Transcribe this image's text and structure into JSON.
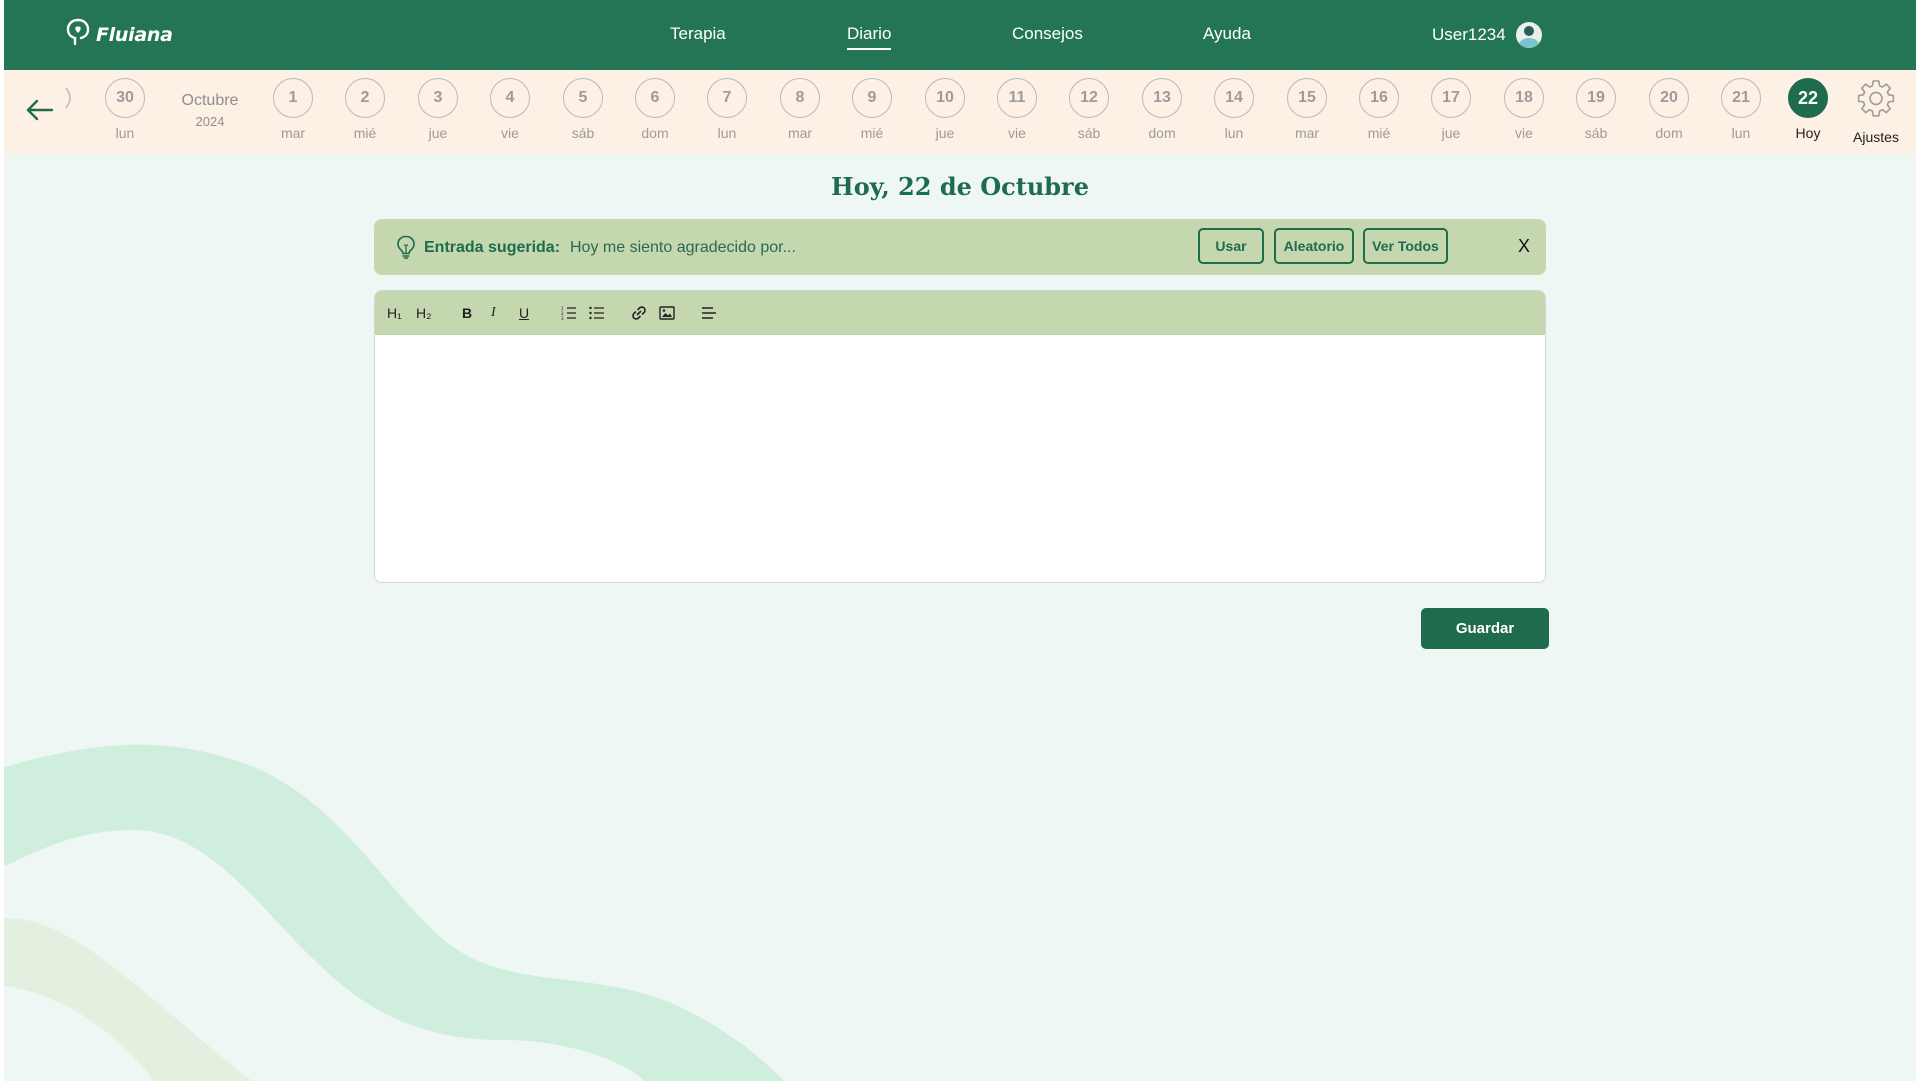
{
  "brand": {
    "name": "Fluiana"
  },
  "nav": {
    "items": [
      {
        "label": "Terapia"
      },
      {
        "label": "Diario",
        "active": true
      },
      {
        "label": "Consejos"
      },
      {
        "label": "Ayuda"
      }
    ],
    "user": "User1234"
  },
  "calendar": {
    "first_day": {
      "num": "30",
      "dow": "lun"
    },
    "month": "Octubre",
    "year": "2024",
    "days": [
      {
        "num": "1",
        "dow": "mar"
      },
      {
        "num": "2",
        "dow": "mié"
      },
      {
        "num": "3",
        "dow": "jue"
      },
      {
        "num": "4",
        "dow": "vie"
      },
      {
        "num": "5",
        "dow": "sáb"
      },
      {
        "num": "6",
        "dow": "dom"
      },
      {
        "num": "7",
        "dow": "lun"
      },
      {
        "num": "8",
        "dow": "mar"
      },
      {
        "num": "9",
        "dow": "mié"
      },
      {
        "num": "10",
        "dow": "jue"
      },
      {
        "num": "11",
        "dow": "vie"
      },
      {
        "num": "12",
        "dow": "sáb"
      },
      {
        "num": "13",
        "dow": "dom"
      },
      {
        "num": "14",
        "dow": "lun"
      },
      {
        "num": "15",
        "dow": "mar"
      },
      {
        "num": "16",
        "dow": "mié"
      },
      {
        "num": "17",
        "dow": "jue"
      },
      {
        "num": "18",
        "dow": "vie"
      },
      {
        "num": "19",
        "dow": "sáb"
      },
      {
        "num": "20",
        "dow": "dom"
      },
      {
        "num": "21",
        "dow": "lun"
      }
    ],
    "today": {
      "num": "22",
      "dow": "Hoy"
    },
    "settings_label": "Ajustes"
  },
  "page": {
    "title": "Hoy, 22 de Octubre"
  },
  "suggestion": {
    "label": "Entrada sugerida:",
    "text": "Hoy me siento agradecido por...",
    "use_label": "Usar",
    "random_label": "Aleatorio",
    "view_all_label": "Ver Todos",
    "close_label": "X"
  },
  "editor": {
    "toolbar": {
      "h1": "H₁",
      "h2": "H₂",
      "bold": "B",
      "italic": "I",
      "underline": "U"
    },
    "content": ""
  },
  "actions": {
    "save_label": "Guardar"
  },
  "colors": {
    "primary": "#247555",
    "dark_green": "#1e6b4e",
    "strip_bg": "#fdf1e6",
    "page_bg": "#eef7f3",
    "suggest_bg": "#c4d7ae"
  }
}
